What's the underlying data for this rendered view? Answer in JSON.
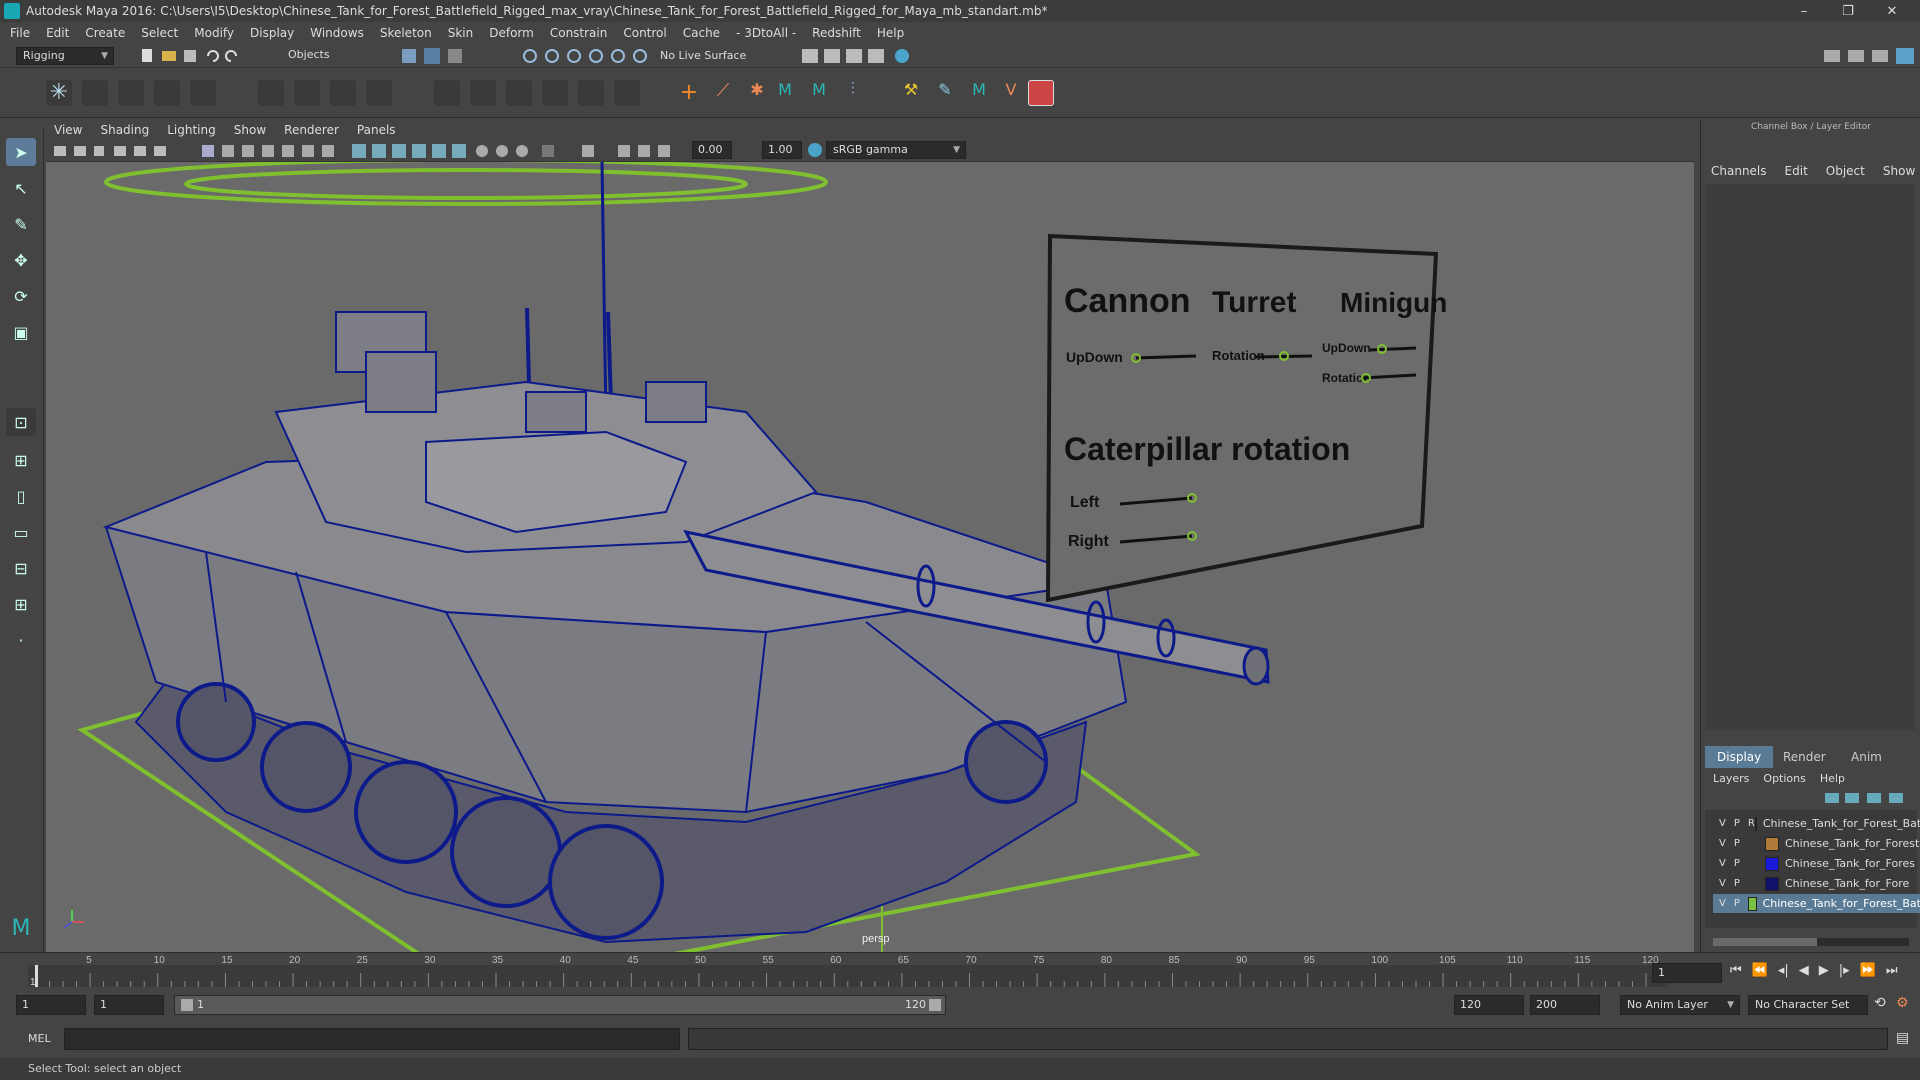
{
  "window": {
    "title": "Autodesk Maya 2016: C:\\Users\\I5\\Desktop\\Chinese_Tank_for_Forest_Battlefield_Rigged_max_vray\\Chinese_Tank_for_Forest_Battlefield_Rigged_for_Maya_mb_standart.mb*",
    "minimize": "–",
    "maximize": "❐",
    "close": "✕"
  },
  "menu": [
    "File",
    "Edit",
    "Create",
    "Select",
    "Modify",
    "Display",
    "Windows",
    "Skeleton",
    "Skin",
    "Deform",
    "Constrain",
    "Control",
    "Cache",
    "- 3DtoAll -",
    "Redshift",
    "Help"
  ],
  "status_line": {
    "mode": "Rigging",
    "selection_mode": "Objects",
    "live_surface": "No Live Surface"
  },
  "viewport": {
    "menu": [
      "View",
      "Shading",
      "Lighting",
      "Show",
      "Renderer",
      "Panels"
    ],
    "value_a": "0.00",
    "value_b": "1.00",
    "color_space": "sRGB gamma",
    "camera_label": "persp"
  },
  "rig_board": {
    "cannon": "Cannon",
    "turret": "Turret",
    "minigun": "Minigun",
    "updown": "UpDown",
    "rotation": "Rotation",
    "minigun_updown": "UpDown",
    "minigun_rotation": "Rotation",
    "caterpillar": "Caterpillar rotation",
    "left": "Left",
    "right": "Right"
  },
  "channel_box": {
    "title": "Channel Box / Layer Editor",
    "menu": [
      "Channels",
      "Edit",
      "Object",
      "Show"
    ]
  },
  "layer_editor": {
    "tabs": [
      "Display",
      "Render",
      "Anim"
    ],
    "menu": [
      "Layers",
      "Options",
      "Help"
    ],
    "layers": [
      {
        "v": "V",
        "p": "P",
        "r": "R",
        "color": "#1f5f2a",
        "name": "Chinese_Tank_for_Forest_Bat"
      },
      {
        "v": "V",
        "p": "P",
        "r": "",
        "color": "#b07a3a",
        "name": "Chinese_Tank_for_Forest"
      },
      {
        "v": "V",
        "p": "P",
        "r": "",
        "color": "#1a1ad8",
        "name": "Chinese_Tank_for_Fores"
      },
      {
        "v": "V",
        "p": "P",
        "r": "",
        "color": "#12126a",
        "name": "Chinese_Tank_for_Fore"
      },
      {
        "v": "V",
        "p": "P",
        "r": "",
        "color": "#7ac043",
        "name": "Chinese_Tank_for_Forest_Bat"
      }
    ]
  },
  "timeline": {
    "ticks": [
      "5",
      "10",
      "15",
      "20",
      "25",
      "30",
      "35",
      "40",
      "45",
      "50",
      "55",
      "60",
      "65",
      "70",
      "75",
      "80",
      "85",
      "90",
      "95",
      "100",
      "105",
      "110",
      "115",
      "120"
    ],
    "start_tick": "1",
    "current_frame": "1",
    "playhead_fraction": 0.0
  },
  "range": {
    "start": "1",
    "playback_start": "1",
    "slider_start": "1",
    "slider_end": "120",
    "playback_end": "120",
    "end": "200",
    "anim_layer": "No Anim Layer",
    "character_set": "No Character Set"
  },
  "command_line": {
    "lang": "MEL"
  },
  "help_line": "Select Tool: select an object",
  "colors": {
    "wire": "#0d1a8a",
    "rig_curve": "#7fbf30",
    "accent": "#5fa6c8"
  }
}
